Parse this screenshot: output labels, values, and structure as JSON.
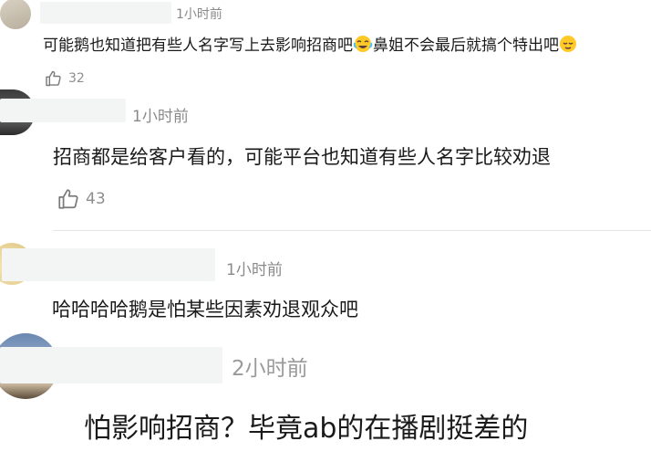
{
  "comments": [
    {
      "time": "1小时前",
      "text_before": "可能鹅也知道把有些人名字写上去影响招商吧",
      "emoji_1": "joy-emoji",
      "text_middle": "鼻姐不会最后就搞个特出吧",
      "emoji_2": "relieved-emoji",
      "likes": "32"
    },
    {
      "time": "1小时前",
      "text": "招商都是给客户看的，可能平台也知道有些人名字比较劝退",
      "likes": "43"
    },
    {
      "time": "1小时前",
      "text": "哈哈哈哈鹅是怕某些因素劝退观众吧"
    },
    {
      "time": "2小时前",
      "text": "怕影响招商？毕竟ab的在播剧挺差的"
    }
  ],
  "icons": {
    "like": "thumbs-up-icon"
  }
}
